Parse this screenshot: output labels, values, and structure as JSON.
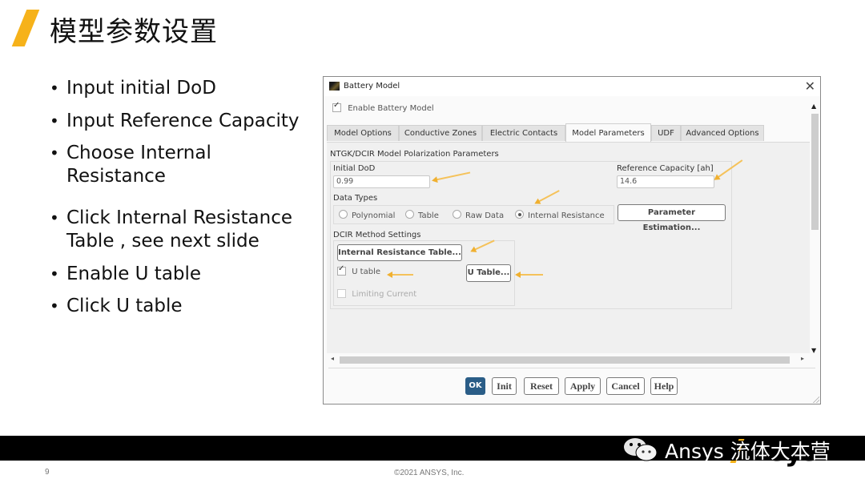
{
  "slide": {
    "title": "模型参数设置",
    "bullets": [
      "Input initial DoD",
      "Input Reference Capacity",
      "Choose Internal Resistance",
      "Click Internal Resistance Table , see next slide",
      "Enable U table",
      "Click U table"
    ],
    "page_number": "9",
    "copyright": "©2021 ANSYS, Inc.",
    "watermark": "Ansys 流体大本营",
    "logo": "Ansys",
    "accent_color": "#f6b21a"
  },
  "dialog": {
    "title": "Battery Model",
    "close_icon": "close-icon",
    "enable_label": "Enable Battery Model",
    "enable_checked": true,
    "tabs": [
      {
        "label": "Model Options",
        "active": false
      },
      {
        "label": "Conductive Zones",
        "active": false
      },
      {
        "label": "Electric Contacts",
        "active": false
      },
      {
        "label": "Model Parameters",
        "active": true
      },
      {
        "label": "UDF",
        "active": false
      },
      {
        "label": "Advanced Options",
        "active": false
      }
    ],
    "section_title": "NTGK/DCIR Model Polarization Parameters",
    "initial_dod": {
      "label": "Initial DoD",
      "value": "0.99"
    },
    "reference_capacity": {
      "label": "Reference Capacity [ah]",
      "value": "14.6"
    },
    "data_types": {
      "label": "Data Types",
      "options": [
        "Polynomial",
        "Table",
        "Raw Data",
        "Internal Resistance"
      ],
      "selected": "Internal Resistance"
    },
    "parameter_estimation_button": "Parameter Estimation...",
    "dcir": {
      "label": "DCIR Method Settings",
      "internal_resistance_table_button": "Internal Resistance Table...",
      "u_table_label": "U table",
      "u_table_checked": true,
      "u_table_button": "U Table...",
      "limiting_current_label": "Limiting Current",
      "limiting_current_checked": false
    },
    "footer_buttons": [
      "OK",
      "Init",
      "Reset",
      "Apply",
      "Cancel",
      "Help"
    ],
    "primary_color": "#2a5d87",
    "annotation_arrow_color": "#f0b030"
  }
}
